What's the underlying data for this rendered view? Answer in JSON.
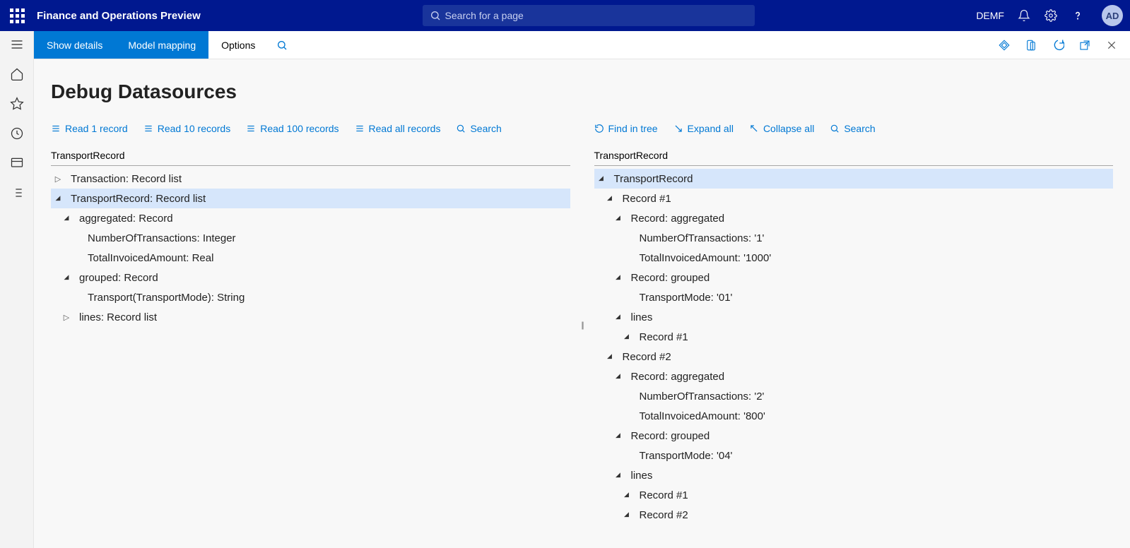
{
  "header": {
    "appTitle": "Finance and Operations Preview",
    "searchPlaceholder": "Search for a page",
    "company": "DEMF",
    "avatarInitials": "AD"
  },
  "actionBar": {
    "showDetails": "Show details",
    "modelMapping": "Model mapping",
    "options": "Options"
  },
  "page": {
    "title": "Debug Datasources"
  },
  "leftPane": {
    "toolbar": {
      "read1": "Read 1 record",
      "read10": "Read 10 records",
      "read100": "Read 100 records",
      "readAll": "Read all records",
      "search": "Search"
    },
    "heading": "TransportRecord",
    "tree": [
      {
        "level": 1,
        "arrow": "collapsed",
        "text": "Transaction: Record list",
        "selected": false
      },
      {
        "level": 1,
        "arrow": "expanded",
        "text": "TransportRecord: Record list",
        "selected": true
      },
      {
        "level": 2,
        "arrow": "expanded",
        "text": "aggregated: Record",
        "selected": false
      },
      {
        "level": 3,
        "arrow": "none",
        "text": "NumberOfTransactions: Integer",
        "selected": false
      },
      {
        "level": 3,
        "arrow": "none",
        "text": "TotalInvoicedAmount: Real",
        "selected": false
      },
      {
        "level": 2,
        "arrow": "expanded",
        "text": "grouped: Record",
        "selected": false
      },
      {
        "level": 3,
        "arrow": "none",
        "text": "Transport(TransportMode): String",
        "selected": false
      },
      {
        "level": 2,
        "arrow": "collapsed",
        "text": "lines: Record list",
        "selected": false
      }
    ]
  },
  "rightPane": {
    "toolbar": {
      "findInTree": "Find in tree",
      "expandAll": "Expand all",
      "collapseAll": "Collapse all",
      "search": "Search"
    },
    "heading": "TransportRecord",
    "tree": [
      {
        "level": 1,
        "arrow": "expanded",
        "text": "TransportRecord",
        "selected": true
      },
      {
        "level": 2,
        "arrow": "expanded",
        "text": "Record #1",
        "selected": false
      },
      {
        "level": 3,
        "arrow": "expanded",
        "text": "Record: aggregated",
        "selected": false
      },
      {
        "level": 4,
        "arrow": "none",
        "text": "NumberOfTransactions: '1'",
        "selected": false
      },
      {
        "level": 4,
        "arrow": "none",
        "text": "TotalInvoicedAmount: '1000'",
        "selected": false
      },
      {
        "level": 3,
        "arrow": "expanded",
        "text": "Record: grouped",
        "selected": false
      },
      {
        "level": 4,
        "arrow": "none",
        "text": "TransportMode: '01'",
        "selected": false
      },
      {
        "level": 3,
        "arrow": "expanded",
        "text": "lines",
        "selected": false
      },
      {
        "level": 4,
        "arrow": "expanded",
        "text": "Record #1",
        "selected": false
      },
      {
        "level": 2,
        "arrow": "expanded",
        "text": "Record #2",
        "selected": false
      },
      {
        "level": 3,
        "arrow": "expanded",
        "text": "Record: aggregated",
        "selected": false
      },
      {
        "level": 4,
        "arrow": "none",
        "text": "NumberOfTransactions: '2'",
        "selected": false
      },
      {
        "level": 4,
        "arrow": "none",
        "text": "TotalInvoicedAmount: '800'",
        "selected": false
      },
      {
        "level": 3,
        "arrow": "expanded",
        "text": "Record: grouped",
        "selected": false
      },
      {
        "level": 4,
        "arrow": "none",
        "text": "TransportMode: '04'",
        "selected": false
      },
      {
        "level": 3,
        "arrow": "expanded",
        "text": "lines",
        "selected": false
      },
      {
        "level": 4,
        "arrow": "expanded",
        "text": "Record #1",
        "selected": false
      },
      {
        "level": 4,
        "arrow": "expanded",
        "text": "Record #2",
        "selected": false
      }
    ]
  }
}
